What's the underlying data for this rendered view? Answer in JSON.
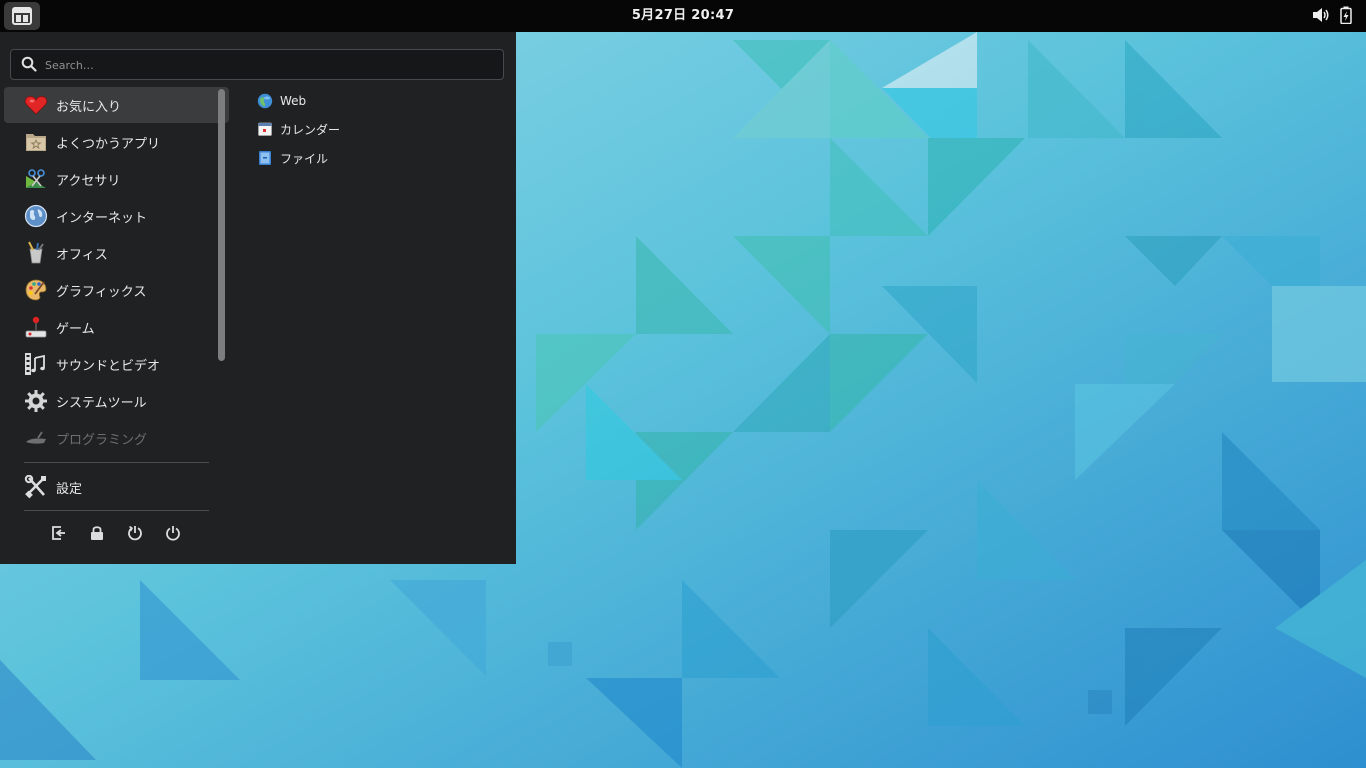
{
  "topbar": {
    "clock": "5月27日  20:47",
    "activities_icon": "activities-grid-icon",
    "volume_icon": "volume-icon",
    "battery_icon": "battery-icon"
  },
  "menu": {
    "search": {
      "placeholder": "Search…",
      "value": ""
    },
    "categories": [
      {
        "label": "お気に入り",
        "icon": "heart-icon",
        "selected": true
      },
      {
        "label": "よくつかうアプリ",
        "icon": "folder-star-icon"
      },
      {
        "label": "アクセサリ",
        "icon": "accessories-icon"
      },
      {
        "label": "インターネット",
        "icon": "globe-icon"
      },
      {
        "label": "オフィス",
        "icon": "office-icon"
      },
      {
        "label": "グラフィックス",
        "icon": "palette-icon"
      },
      {
        "label": "ゲーム",
        "icon": "joystick-icon"
      },
      {
        "label": "サウンドとビデオ",
        "icon": "film-music-icon"
      },
      {
        "label": "システムツール",
        "icon": "gear-icon"
      },
      {
        "label": "プログラミング",
        "icon": "programming-icon",
        "disabled": true
      }
    ],
    "settings_label": "設定",
    "power_icons": [
      "logout-icon",
      "lock-icon",
      "restart-icon",
      "power-icon"
    ],
    "apps": [
      {
        "label": "Web",
        "icon": "web-globe-icon"
      },
      {
        "label": "カレンダー",
        "icon": "calendar-icon"
      },
      {
        "label": "ファイル",
        "icon": "files-icon"
      }
    ]
  },
  "colors": {
    "panel": "#060606",
    "menu_bg": "#1f2122",
    "selection": "#3a3c3e",
    "wallpaper_base": "#4fb6dc"
  }
}
